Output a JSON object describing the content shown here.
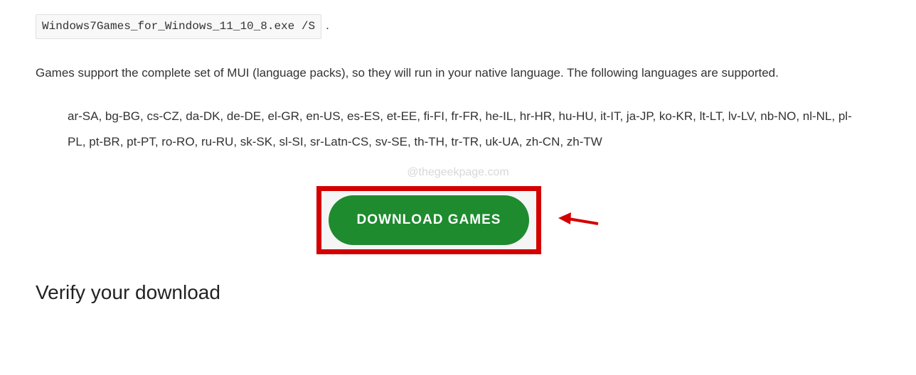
{
  "code_command": "Windows7Games_for_Windows_11_10_8.exe /S",
  "intro_paragraph": "Games support the complete set of MUI (language packs), so they will run in your native language. The following languages are supported.",
  "languages_text": "ar-SA, bg-BG, cs-CZ, da-DK, de-DE, el-GR, en-US, es-ES, et-EE, fi-FI, fr-FR, he-IL, hr-HR, hu-HU, it-IT, ja-JP, ko-KR, lt-LT, lv-LV, nb-NO, nl-NL, pl-PL, pt-BR, pt-PT, ro-RO, ru-RU, sk-SK, sl-SI, sr-Latn-CS, sv-SE, th-TH, tr-TR, uk-UA, zh-CN, zh-TW",
  "watermark": "@thegeekpage.com",
  "download_button_label": "DOWNLOAD GAMES",
  "verify_heading": "Verify your download",
  "colors": {
    "highlight_border": "#d40000",
    "button_bg": "#1e8b2f",
    "arrow": "#d40000"
  }
}
